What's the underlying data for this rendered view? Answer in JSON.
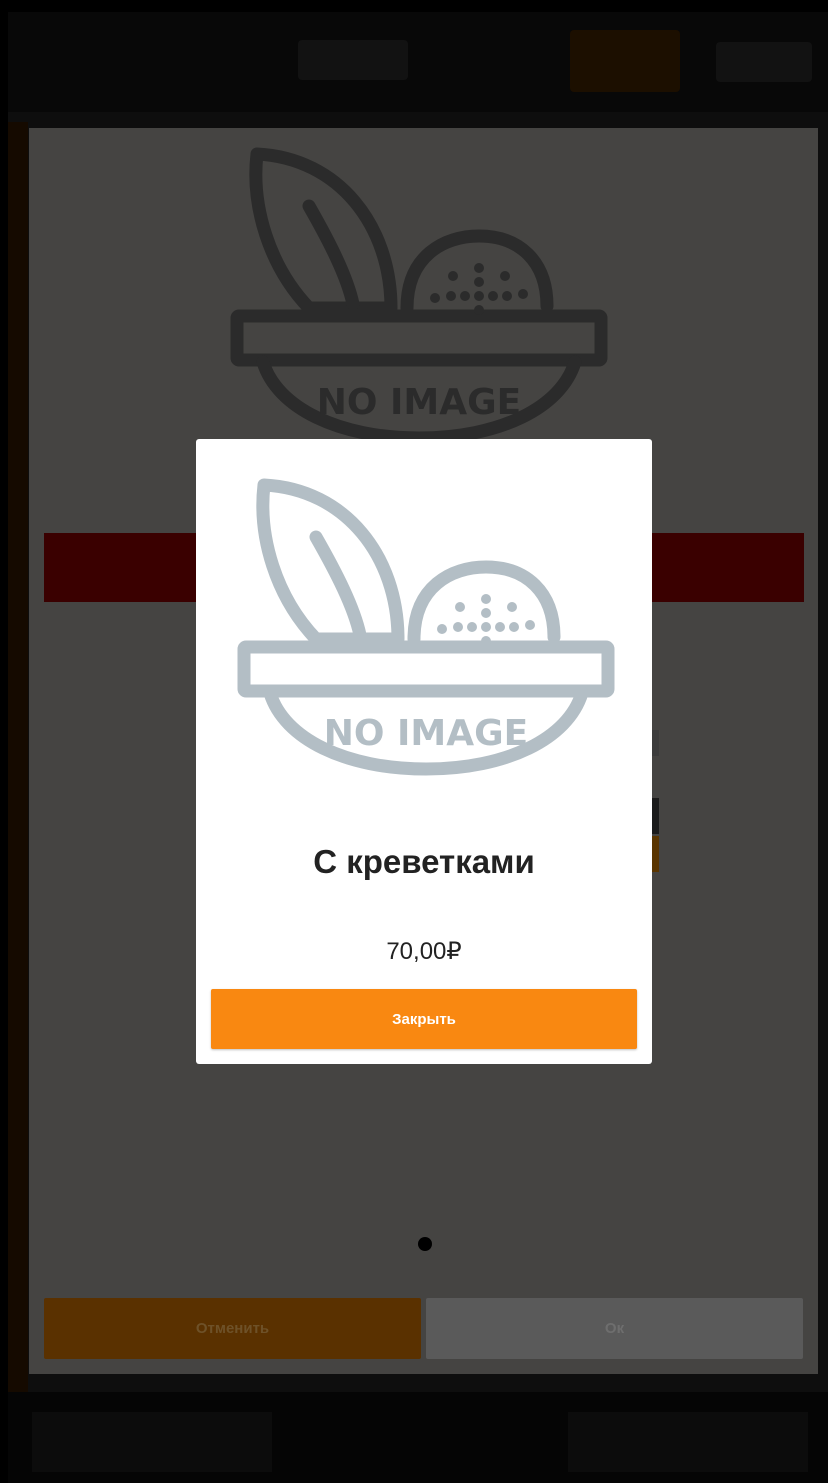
{
  "colors": {
    "accent": "#f98811",
    "placeholder_gray": "#b3bec5",
    "placeholder_dim": "#2b2b2b"
  },
  "placeholder": {
    "text": "NO IMAGE",
    "icon": "no-image-bowl-icon"
  },
  "dialog": {
    "cancel_label": "Отменить",
    "ok_label": "Ок"
  },
  "popup": {
    "product_name": "С креветками",
    "price": "70,00₽",
    "close_label": "Закрыть"
  }
}
